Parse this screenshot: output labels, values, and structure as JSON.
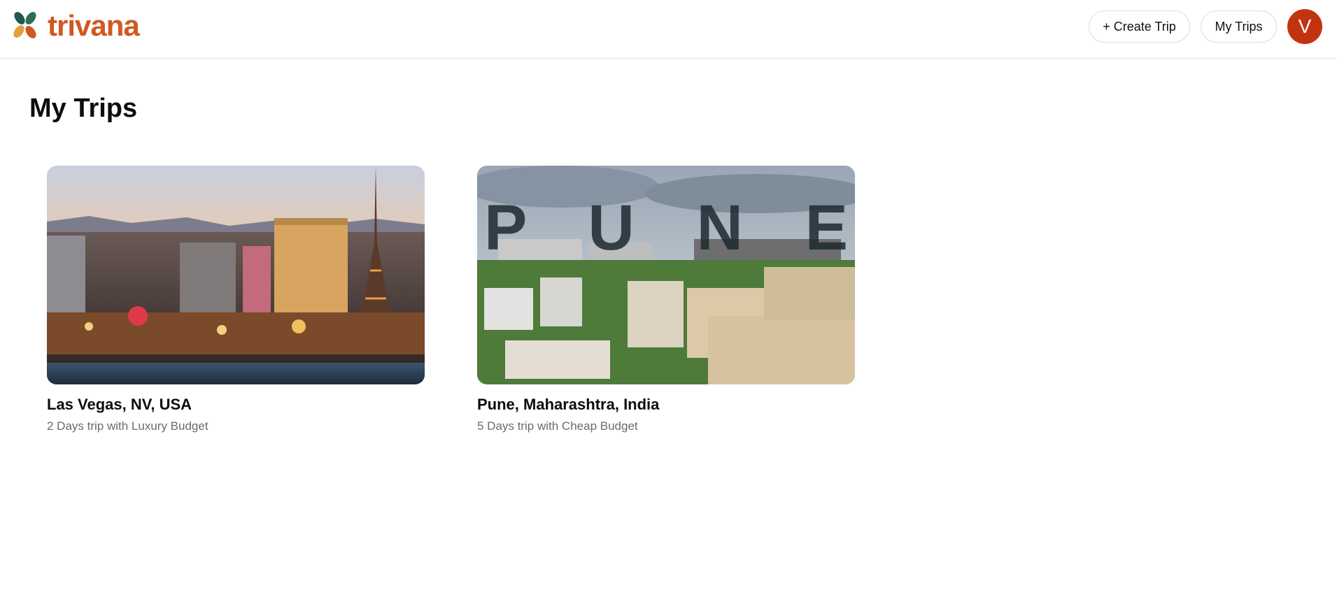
{
  "app": {
    "brand": "trivana",
    "brand_color": "#d2581f"
  },
  "nav": {
    "create_trip": "+ Create Trip",
    "my_trips": "My Trips",
    "avatar_initial": "V",
    "avatar_color": "#c2330f"
  },
  "page": {
    "title": "My Trips"
  },
  "trips": [
    {
      "title": "Las Vegas, NV, USA",
      "subtitle": "2 Days trip with Luxury Budget",
      "image": "las-vegas-skyline-photo"
    },
    {
      "title": "Pune, Maharashtra, India",
      "subtitle": "5 Days trip with Cheap Budget",
      "image": "pune-city-photo",
      "image_overlay_text": "P U N E"
    }
  ]
}
